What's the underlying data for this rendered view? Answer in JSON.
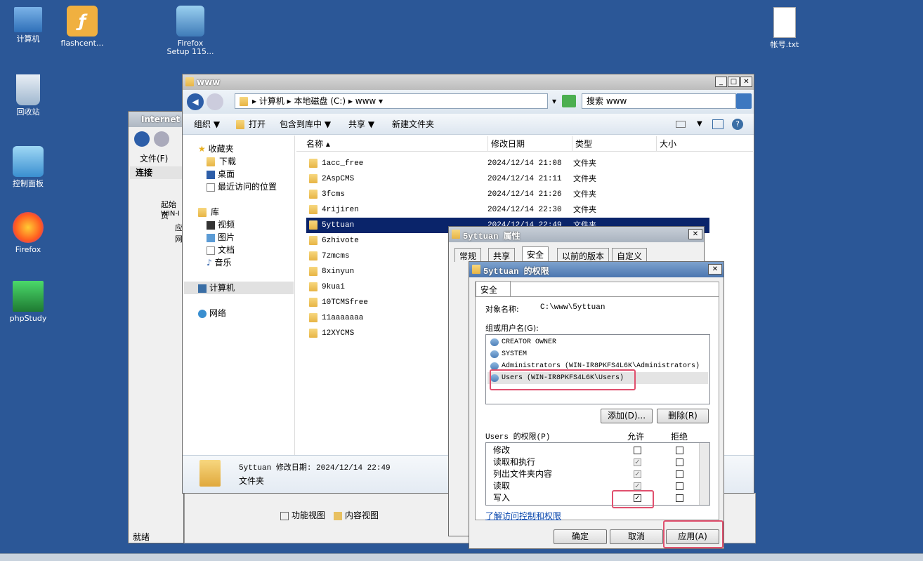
{
  "desktop": {
    "icons": [
      {
        "label": "计算机",
        "id": "computer"
      },
      {
        "label": "flashcent...",
        "id": "flash"
      },
      {
        "label": "Firefox\nSetup 115...",
        "id": "ffsetup"
      },
      {
        "label": "帐号.txt",
        "id": "txt"
      },
      {
        "label": "回收站",
        "id": "recycle"
      },
      {
        "label": "控制面板",
        "id": "cpanel"
      },
      {
        "label": "Firefox",
        "id": "firefox"
      },
      {
        "label": "phpStudy",
        "id": "phpstudy"
      }
    ]
  },
  "ie": {
    "title": "Internet",
    "menu_file": "文件(F)",
    "conn": "连接",
    "tree": [
      "起始页",
      "WIN-I",
      "应",
      "网"
    ],
    "status": "就绪",
    "view_func": "功能视图",
    "view_content": "内容视图"
  },
  "explorer": {
    "title": "www",
    "address": [
      "计算机",
      "本地磁盘 (C:)",
      "www"
    ],
    "search_placeholder": "搜索 www",
    "toolbar": {
      "organize": "组织 ▼",
      "open": "打开",
      "include": "包含到库中 ▼",
      "share": "共享 ▼",
      "newfolder": "新建文件夹"
    },
    "nav": {
      "favorites": "收藏夹",
      "downloads": "下载",
      "desktop": "桌面",
      "recent": "最近访问的位置",
      "libraries": "库",
      "videos": "视频",
      "pictures": "图片",
      "documents": "文档",
      "music": "音乐",
      "computer": "计算机",
      "network": "网络"
    },
    "columns": {
      "name": "名称",
      "date": "修改日期",
      "type": "类型",
      "size": "大小"
    },
    "files": [
      {
        "name": "1acc_free",
        "date": "2024/12/14 21:08",
        "type": "文件夹"
      },
      {
        "name": "2AspCMS",
        "date": "2024/12/14 21:11",
        "type": "文件夹"
      },
      {
        "name": "3fcms",
        "date": "2024/12/14 21:26",
        "type": "文件夹"
      },
      {
        "name": "4rijiren",
        "date": "2024/12/14 22:30",
        "type": "文件夹"
      },
      {
        "name": "5yttuan",
        "date": "2024/12/14 22:49",
        "type": "文件夹"
      },
      {
        "name": "6zhivote",
        "date": "",
        "type": ""
      },
      {
        "name": "7zmcms",
        "date": "",
        "type": ""
      },
      {
        "name": "8xinyun",
        "date": "",
        "type": ""
      },
      {
        "name": "9kuai",
        "date": "",
        "type": ""
      },
      {
        "name": "10TCMSfree",
        "date": "",
        "type": ""
      },
      {
        "name": "11aaaaaaa",
        "date": "",
        "type": ""
      },
      {
        "name": "12XYCMS",
        "date": "",
        "type": ""
      }
    ],
    "details": {
      "name": "5yttuan",
      "datelabel": "修改日期: 2024/12/14 22:49",
      "kind": "文件夹"
    }
  },
  "props": {
    "title": "5yttuan 属性",
    "tabs": [
      "常规",
      "共享",
      "安全",
      "以前的版本",
      "自定义"
    ]
  },
  "perm": {
    "title": "5yttuan 的权限",
    "tab": "安全",
    "objlabel": "对象名称:",
    "objvalue": "C:\\www\\5yttuan",
    "grouplabel": "组或用户名(G):",
    "users": [
      "CREATOR OWNER",
      "SYSTEM",
      "Administrators (WIN-IR8PKFS4L6K\\Administrators)",
      "Users (WIN-IR8PKFS4L6K\\Users)"
    ],
    "add": "添加(D)...",
    "remove": "删除(R)",
    "permlabel": "Users 的权限(P)",
    "allow": "允许",
    "deny": "拒绝",
    "perms": [
      {
        "name": "修改",
        "allow": false,
        "allow_dis": false
      },
      {
        "name": "读取和执行",
        "allow": true,
        "allow_dis": true
      },
      {
        "name": "列出文件夹内容",
        "allow": true,
        "allow_dis": true
      },
      {
        "name": "读取",
        "allow": true,
        "allow_dis": true
      },
      {
        "name": "写入",
        "allow": true,
        "allow_dis": false
      }
    ],
    "link": "了解访问控制和权限",
    "ok": "确定",
    "cancel": "取消",
    "apply": "应用(A)"
  }
}
